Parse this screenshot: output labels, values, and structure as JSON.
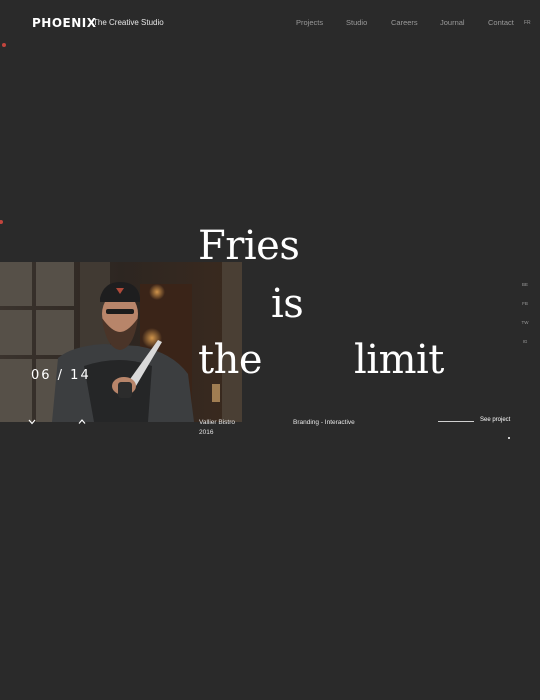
{
  "header": {
    "logo": "PHOENIX",
    "tagline": "The Creative Studio",
    "nav": [
      "Projects",
      "Studio",
      "Careers",
      "Journal",
      "Contact"
    ],
    "lang": "FR"
  },
  "slider": {
    "counter": "06 / 14",
    "headline": [
      "Fries",
      "is",
      "the",
      "limit"
    ],
    "client": "Vallier Bistro",
    "year": "2016",
    "services": "Branding - Interactive",
    "cta": "See project"
  },
  "social": [
    "BE",
    "FB",
    "TW",
    "IG"
  ],
  "colors": {
    "background": "#2a2a2a",
    "accent": "#c2453d",
    "text": "#ffffff",
    "muted": "#9a9a9a"
  }
}
